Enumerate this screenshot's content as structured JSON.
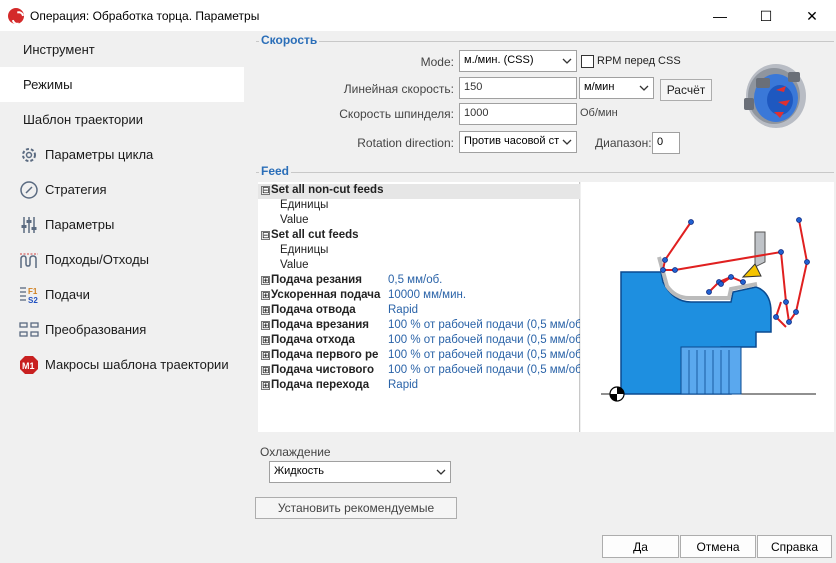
{
  "window": {
    "title": "Операция: Обработка торца. Параметры",
    "minimize_glyph": "—",
    "maximize_glyph": "☐",
    "close_glyph": "✕"
  },
  "sidebar": {
    "items": [
      {
        "label": "Инструмент",
        "icon": null
      },
      {
        "label": "Режимы",
        "icon": null
      },
      {
        "label": "Шаблон траектории",
        "icon": null
      },
      {
        "label": "Параметры цикла",
        "icon": "cycle-gear-icon"
      },
      {
        "label": "Стратегия",
        "icon": "compass-icon"
      },
      {
        "label": "Параметры",
        "icon": "sliders-icon"
      },
      {
        "label": "Подходы/Отходы",
        "icon": "approach-path-icon"
      },
      {
        "label": "Подачи",
        "icon": "feeds-f1-s2-icon"
      },
      {
        "label": "Преобразования",
        "icon": "transform-icon"
      },
      {
        "label": "Макросы шаблона траектории",
        "icon": "m1-macro-icon"
      }
    ],
    "active_index": 1,
    "icon_texts": {
      "feeds_f1": "F1",
      "feeds_s2": "S2",
      "macro": "M1"
    }
  },
  "speed": {
    "group_title": "Скорость",
    "mode_label": "Mode:",
    "mode_value": "м./мин. (CSS)",
    "rpm_checkbox_label": "RPM перед CSS",
    "rpm_checked": false,
    "linear_speed_label": "Линейная скорость:",
    "linear_speed_value": "150",
    "linear_speed_unit": "м/мин",
    "calc_button": "Расчёт",
    "spindle_speed_label": "Скорость шпинделя:",
    "spindle_speed_value": "1000",
    "spindle_speed_unit": "Об/мин",
    "rotation_label": "Rotation direction:",
    "rotation_value": "Против часовой ст",
    "range_label": "Диапазон:",
    "range_value": "0"
  },
  "feed": {
    "group_title": "Feed",
    "rows": [
      {
        "type": "group",
        "expander": "⊟",
        "name": "Set all non-cut feeds",
        "value": ""
      },
      {
        "type": "child",
        "name": "Единицы",
        "value": ""
      },
      {
        "type": "child",
        "name": "Value",
        "value": ""
      },
      {
        "type": "group",
        "expander": "⊟",
        "name": "Set all cut feeds",
        "value": ""
      },
      {
        "type": "child",
        "name": "Единицы",
        "value": ""
      },
      {
        "type": "child",
        "name": "Value",
        "value": ""
      },
      {
        "type": "item",
        "expander": "⊞",
        "name": "Подача резания",
        "value": "0,5 мм/об."
      },
      {
        "type": "item",
        "expander": "⊞",
        "name": "Ускоренная подача",
        "value": "10000 мм/мин."
      },
      {
        "type": "item",
        "expander": "⊞",
        "name": "Подача отвода",
        "value": "Rapid"
      },
      {
        "type": "item",
        "expander": "⊞",
        "name": "Подача врезания",
        "value": "100 % от рабочей подачи (0,5 мм/об."
      },
      {
        "type": "item",
        "expander": "⊞",
        "name": "Подача отхода",
        "value": "100 % от рабочей подачи (0,5 мм/об."
      },
      {
        "type": "item",
        "expander": "⊞",
        "name": "Подача первого ре",
        "value": "100 % от рабочей подачи (0,5 мм/об."
      },
      {
        "type": "item",
        "expander": "⊞",
        "name": "Подача чистового",
        "value": "100 % от рабочей подачи (0,5 мм/об."
      },
      {
        "type": "item",
        "expander": "⊞",
        "name": "Подача перехода",
        "value": "Rapid"
      }
    ]
  },
  "coolant": {
    "label": "Охлаждение",
    "value": "Жидкость"
  },
  "recommend_button": "Установить рекомендуемые",
  "dialog_buttons": {
    "ok": "Да",
    "cancel": "Отмена",
    "help": "Справка"
  },
  "colors": {
    "accent_blue": "#2a6eb8",
    "part_blue": "#1e8fe0",
    "toolpath_red": "#e02020",
    "sidebar_bg": "#f0f0f0"
  }
}
